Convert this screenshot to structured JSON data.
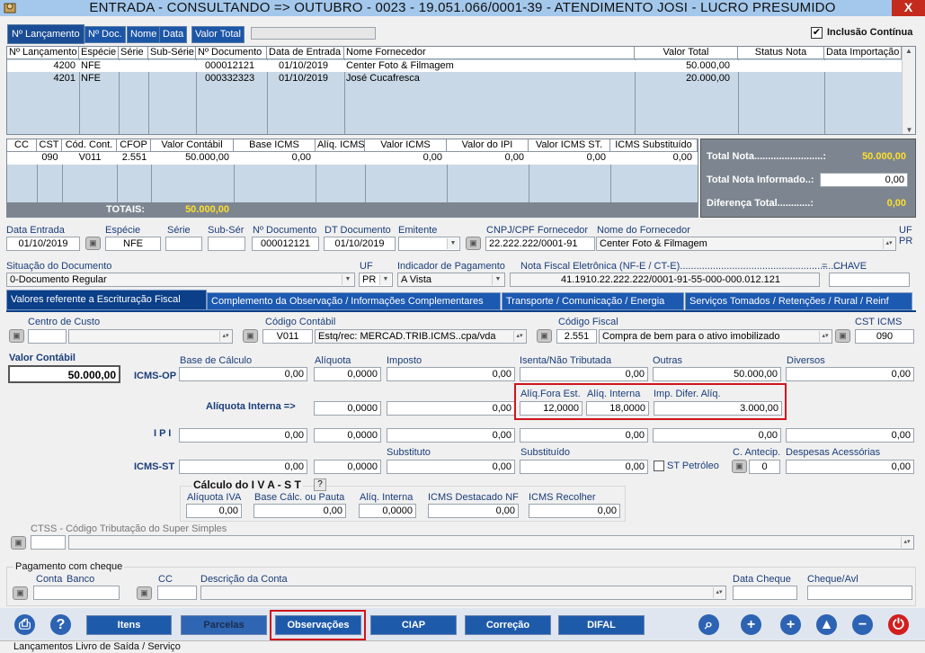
{
  "window": {
    "title": "ENTRADA  -  CONSULTANDO   =>   OUTUBRO   -  0023 - 19.051.066/0001-39 - ATENDIMENTO JOSI - LUCRO PRESUMIDO",
    "close": "X"
  },
  "tabs": [
    "Nº Lançamento",
    "Nº Doc.",
    "Nome",
    "Data",
    "Valor Total"
  ],
  "inclusao_continua": "Inclusão Contínua",
  "notes_table": {
    "headers": [
      "Nº Lançamento",
      "Espécie",
      "Série",
      "Sub-Série",
      "Nº Documento",
      "Data de Entrada",
      "Nome Fornecedor",
      "Valor Total",
      "Status Nota",
      "Data Importação"
    ],
    "rows": [
      [
        "4200",
        "NFE",
        "",
        "",
        "000012121",
        "01/10/2019",
        "Center Foto & Filmagem",
        "50.000,00",
        "",
        ""
      ],
      [
        "4201",
        "NFE",
        "",
        "",
        "000332323",
        "01/10/2019",
        "José Cucafresca",
        "20.000,00",
        "",
        ""
      ]
    ]
  },
  "items_table": {
    "headers": [
      "CC",
      "CST",
      "Cód. Cont.",
      "CFOP",
      "Valor Contábil",
      "Base ICMS",
      "Alíq. ICMS",
      "Valor ICMS",
      "Valor do IPI",
      "Valor ICMS ST.",
      "ICMS Substituído"
    ],
    "row": [
      "",
      "090",
      "V011",
      "2.551",
      "50.000,00",
      "0,00",
      "",
      "0,00",
      "0,00",
      "0,00",
      "0,00"
    ],
    "totais_label": "TOTAIS:",
    "totais_value": "50.000,00"
  },
  "summary": {
    "total_nota_label": "Total Nota.........................:",
    "total_nota": "50.000,00",
    "total_informado_label": "Total Nota Informado..:",
    "total_informado": "0,00",
    "diferenca_label": "Diferença Total............:",
    "diferenca": "0,00"
  },
  "doc": {
    "data_entrada_label": "Data Entrada",
    "data_entrada": "01/10/2019",
    "especie_label": "Espécie",
    "especie": "NFE",
    "serie_label": "Série",
    "serie": "",
    "subser_label": "Sub-Sér",
    "subser": "",
    "ndoc_label": "Nº Documento",
    "ndoc": "000012121",
    "dtdoc_label": "DT Documento",
    "dtdoc": "01/10/2019",
    "emitente_label": "Emitente",
    "emitente": "",
    "cnpj_label": "CNPJ/CPF Fornecedor",
    "cnpj": "22.222.222/0001-91",
    "nome_label": "Nome do Fornecedor",
    "nome": "Center Foto & Filmagem",
    "uf_label": "UF",
    "uf": "PR",
    "situacao_label": "Situação do Documento",
    "situacao": "0-Documento Regular",
    "uf2_label": "UF",
    "uf2": "PR",
    "indicador_label": "Indicador de Pagamento",
    "indicador": "A Vista",
    "nfe_label": "Nota Fiscal Eletrônica (NF-E / CT-E)...........................................................",
    "eq": "=",
    "chave_label": "CHAVE",
    "chave": "41.1910.22.222.222/0001-91-55-000-000.012.121"
  },
  "section_tabs": [
    "Valores referente a Escrituração Fiscal",
    "Complemento da Observação / Informações Complementares",
    "Transporte / Comunicação / Energia",
    "Serviços Tomados / Retenções / Rural / Reinf"
  ],
  "fiscal": {
    "centro_label": "Centro de Custo",
    "centro": "",
    "codcont_label": "Código Contábil",
    "codcont": "V011",
    "codcont_desc": "Estq/rec: MERCAD.TRIB.ICMS..cpa/vda",
    "codfiscal_label": "Código Fiscal",
    "codfiscal": "2.551",
    "codfiscal_desc": "Compra de bem para o ativo imobilizado",
    "cst_label": "CST ICMS",
    "cst": "090",
    "valor_contabil_label": "Valor Contábil",
    "valor_contabil": "50.000,00",
    "h_base": "Base de Cálculo",
    "h_aliq": "Alíquota",
    "h_imposto": "Imposto",
    "h_isenta": "Isenta/Não Tributada",
    "h_outras": "Outras",
    "h_diversos": "Diversos",
    "icmsop_label": "ICMS-OP",
    "icmsop": [
      "0,00",
      "0,0000",
      "0,00",
      "0,00",
      "50.000,00",
      "0,00"
    ],
    "aliq_interna_label": "Alíquota Interna =>",
    "aliq_interna": [
      "0,0000",
      "0,00"
    ],
    "h_fora": "Alíq.Fora Est.",
    "h_interna": "Alíq. Interna",
    "h_difer": "Imp. Difer. Alíq.",
    "difal": [
      "12,0000",
      "18,0000",
      "3.000,00"
    ],
    "ipi_label": "I P I",
    "ipi": [
      "0,00",
      "0,0000",
      "0,00",
      "0,00",
      "0,00",
      "0,00"
    ],
    "h_substituto": "Substituto",
    "h_substituido": "Substituído",
    "h_antecip": "C. Antecip.",
    "h_despesas": "Despesas Acessórias",
    "icmsst_label": "ICMS-ST",
    "icmsst": [
      "0,00",
      "0,0000",
      "0,00",
      "0,00"
    ],
    "st_petroleo": "ST Petróleo",
    "antecip": "0",
    "despesas": "0,00",
    "iva_title": "Cálculo   do   I V A - S T",
    "iva_help": "?",
    "h_aliq_iva": "Alíquota IVA",
    "h_base_pauta": "Base Cálc. ou Pauta",
    "h_aliq_int": "Alíq. Interna",
    "h_icms_dest": "ICMS Destacado NF",
    "h_icms_rec": "ICMS Recolher",
    "iva": [
      "0,00",
      "0,00",
      "0,0000",
      "0,00",
      "0,00"
    ],
    "ctss_label": "CTSS - Código Tributação do Super Simples"
  },
  "pagamento": {
    "title": "Pagamento com cheque",
    "conta_label": "Conta",
    "banco_label": "Banco",
    "cc_label": "CC",
    "desc_label": "Descrição da Conta",
    "data_cheque_label": "Data Cheque",
    "cheque_label": "Cheque/Avl"
  },
  "bottom_buttons": [
    "Itens",
    "Parcelas",
    "Observações",
    "CIAP",
    "Correção",
    "DIFAL"
  ],
  "status_bar": "Lançamentos Livro de Saída / Serviço",
  "colors": {
    "tab_blue": "#1c56a6",
    "summary_yellow": "#ffdf2b",
    "highlight_red": "#d0141c"
  }
}
